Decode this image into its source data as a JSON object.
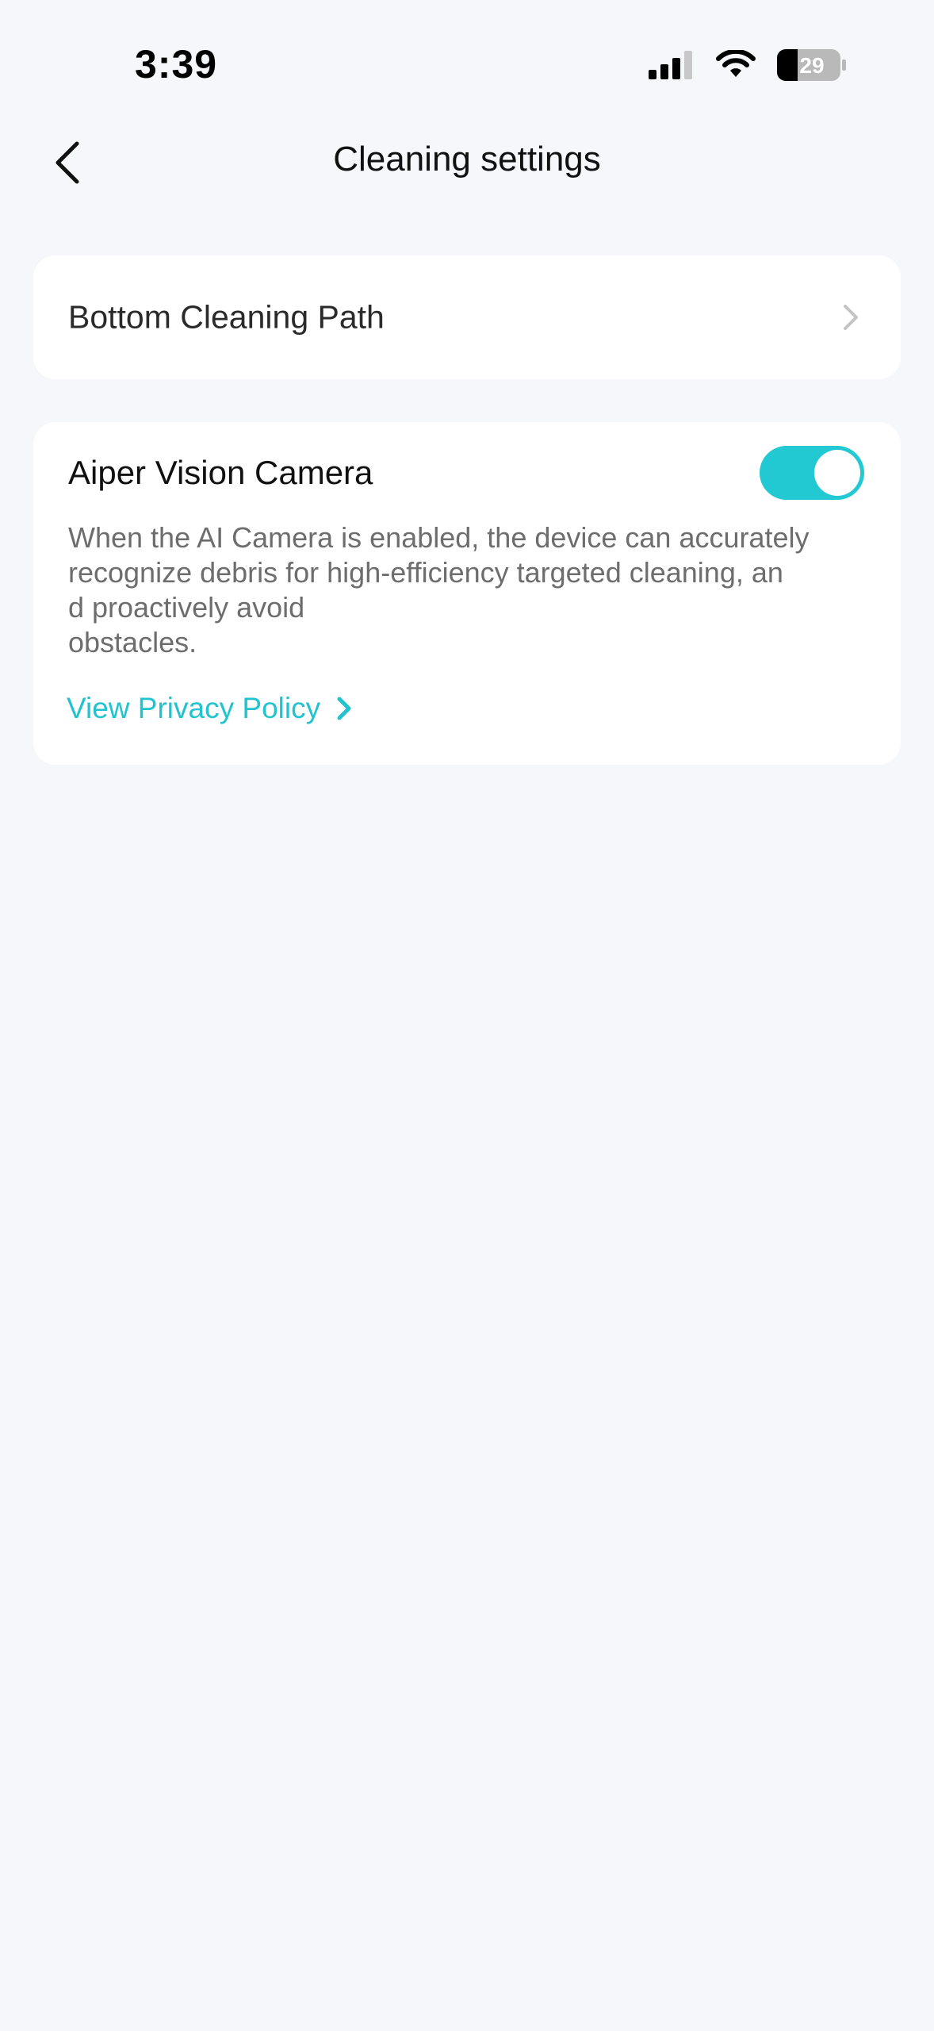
{
  "status_bar": {
    "time": "3:39",
    "battery_level": "29",
    "icons": [
      "signal-icon",
      "wifi-icon",
      "battery-icon"
    ]
  },
  "header": {
    "title": "Cleaning settings",
    "back_icon": "chevron-left-icon"
  },
  "bottom_path": {
    "label": "Bottom Cleaning Path",
    "chevron_icon": "chevron-right-icon"
  },
  "camera": {
    "title": "Aiper Vision Camera",
    "enabled": true,
    "description": "When the AI Camera is enabled, the device can accurately\n recognize debris for high-efficiency targeted cleaning, an\nd proactively avoid\nobstacles.",
    "privacy_link": "View Privacy Policy"
  },
  "colors": {
    "accent": "#22c8d2",
    "link": "#22c3cf",
    "background": "#f6f7fb",
    "card": "#ffffff",
    "secondary_text": "#6d6d6d"
  }
}
